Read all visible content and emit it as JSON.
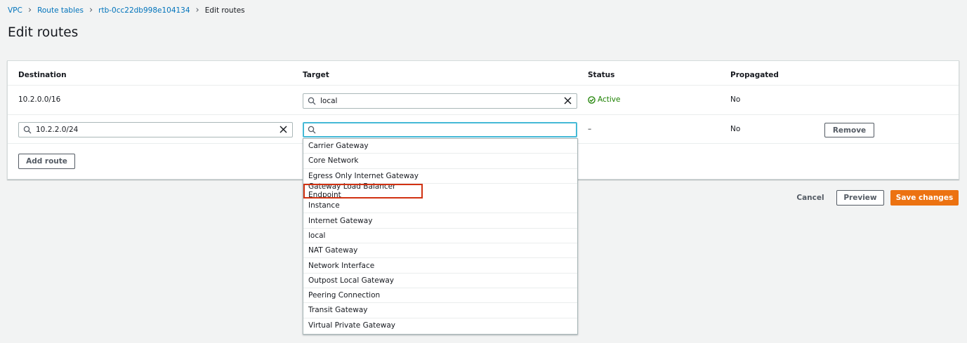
{
  "breadcrumb": {
    "items": [
      "VPC",
      "Route tables",
      "rtb-0cc22db998e104134"
    ],
    "current": "Edit routes"
  },
  "page_title": "Edit routes",
  "table": {
    "headers": {
      "destination": "Destination",
      "target": "Target",
      "status": "Status",
      "propagated": "Propagated"
    },
    "row1": {
      "destination": "10.2.0.0/16",
      "target_value": "local",
      "status": "Active",
      "propagated": "No"
    },
    "row2": {
      "destination_value": "10.2.2.0/24",
      "target_value": "",
      "status": "–",
      "propagated": "No",
      "remove_label": "Remove"
    }
  },
  "add_route_label": "Add route",
  "dropdown": {
    "options": [
      "Carrier Gateway",
      "Core Network",
      "Egress Only Internet Gateway",
      "Gateway Load Balancer Endpoint",
      "Instance",
      "Internet Gateway",
      "local",
      "NAT Gateway",
      "Network Interface",
      "Outpost Local Gateway",
      "Peering Connection",
      "Transit Gateway",
      "Virtual Private Gateway"
    ],
    "highlighted": "Gateway Load Balancer Endpoint"
  },
  "footer": {
    "cancel_label": "Cancel",
    "preview_label": "Preview",
    "save_label": "Save changes"
  },
  "colors": {
    "primary": "#ec7211",
    "link": "#0073bb",
    "active": "#1d8102",
    "focus": "#44b9d6",
    "highlight_outline": "#d13212"
  }
}
